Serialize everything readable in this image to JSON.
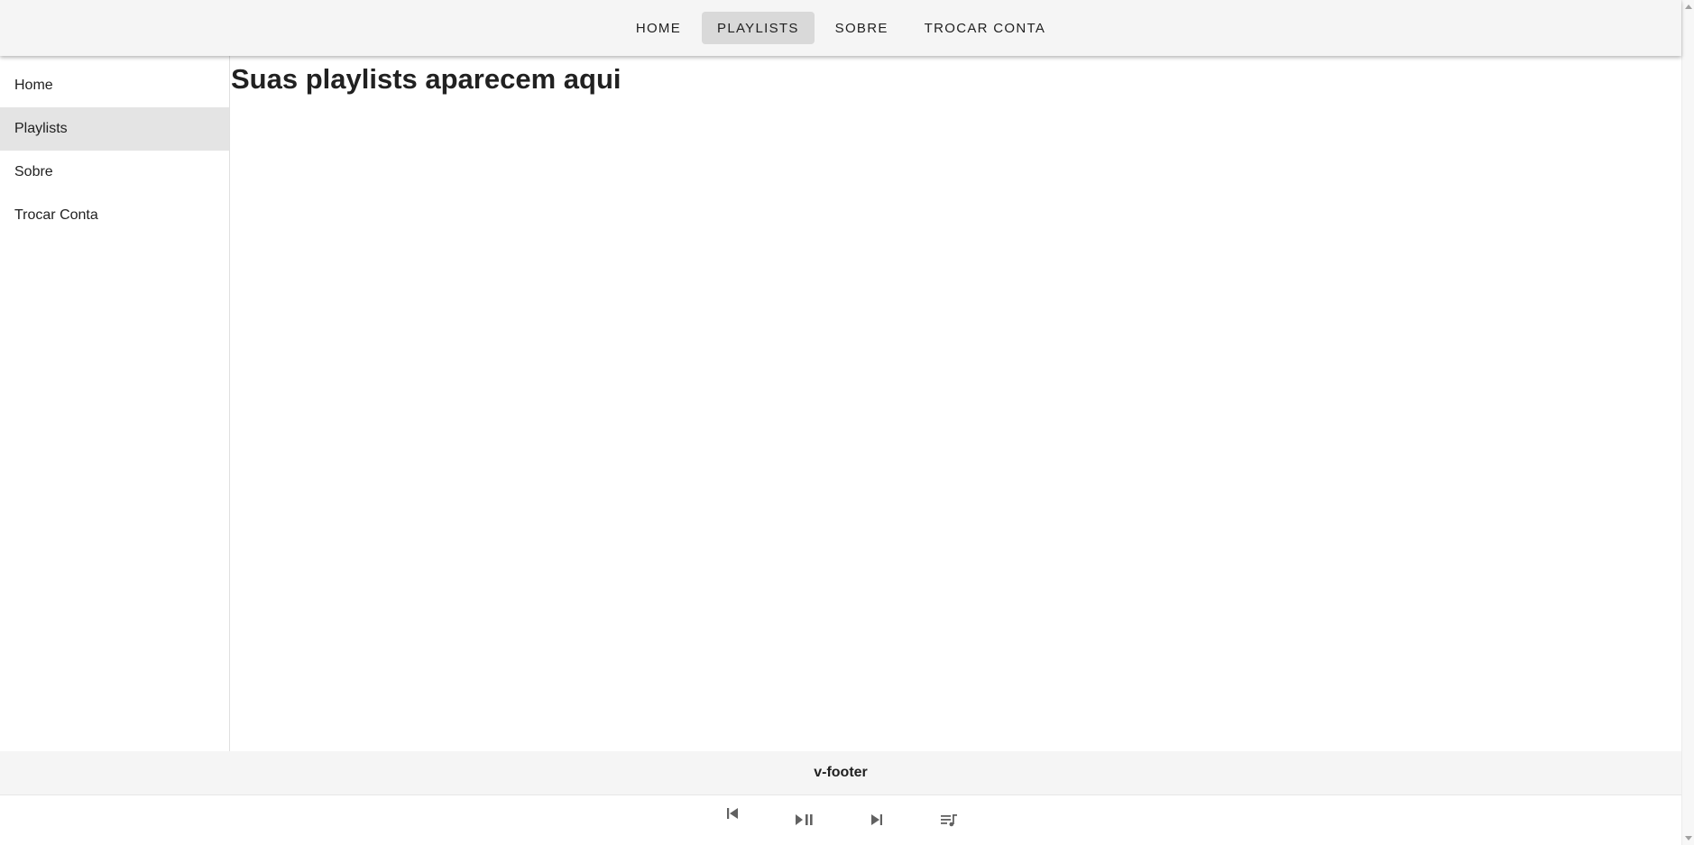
{
  "topbar": {
    "items": [
      {
        "label": "HOME",
        "active": false
      },
      {
        "label": "PLAYLISTS",
        "active": true
      },
      {
        "label": "SOBRE",
        "active": false
      },
      {
        "label": "TROCAR CONTA",
        "active": false
      }
    ]
  },
  "sidebar": {
    "items": [
      {
        "label": "Home",
        "active": false
      },
      {
        "label": "Playlists",
        "active": true
      },
      {
        "label": "Sobre",
        "active": false
      },
      {
        "label": "Trocar Conta",
        "active": false
      }
    ]
  },
  "main": {
    "title": "Suas playlists aparecem aqui"
  },
  "footer": {
    "text": "v-footer"
  },
  "player": {
    "controls": [
      "skip-previous-icon",
      "play-pause-icon",
      "skip-next-icon",
      "queue-music-icon"
    ]
  },
  "colors": {
    "bar_background": "#f5f5f5",
    "active_tab": "#d9d9d9",
    "active_sidebar": "#e4e4e4",
    "text": "#212121",
    "icon": "#616161"
  }
}
